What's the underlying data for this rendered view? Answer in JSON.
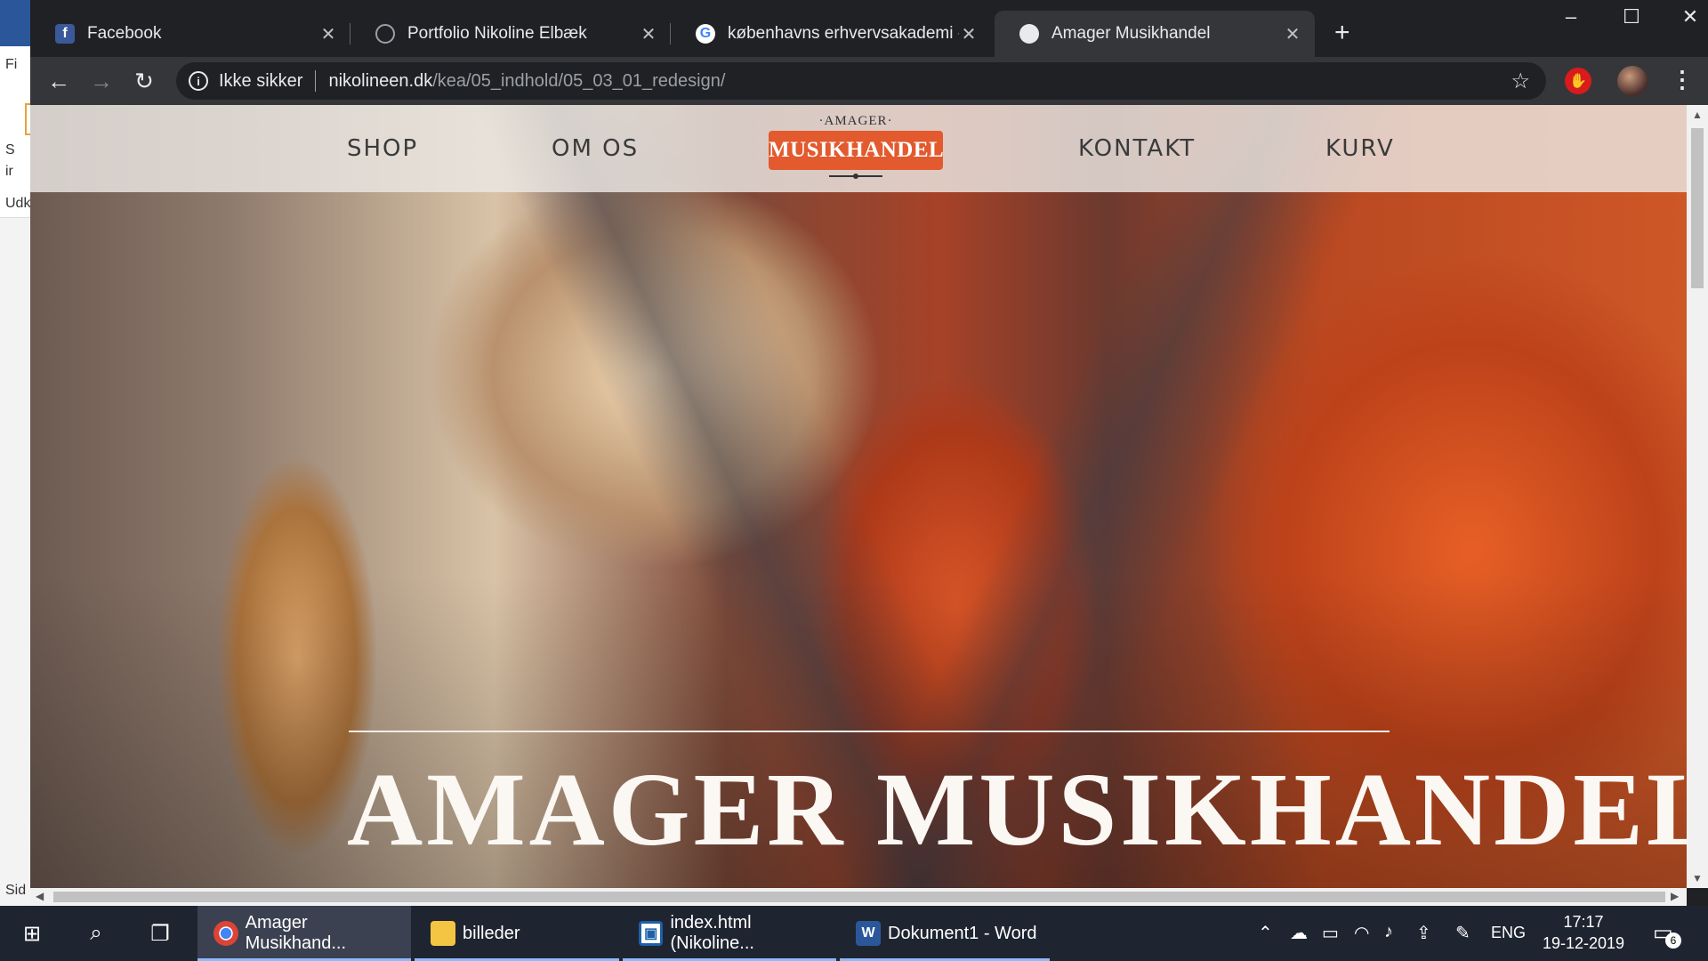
{
  "background_app": {
    "text_top": "Fi",
    "text_mid1": "S",
    "text_mid2": "ir",
    "text_udk": "Udk",
    "text_sid": "Sid"
  },
  "tabs": [
    {
      "title": "Facebook",
      "favicon": "facebook-icon"
    },
    {
      "title": "Portfolio Nikoline Elbæk",
      "favicon": "globe-icon"
    },
    {
      "title": "københavns erhvervsakademi - G",
      "favicon": "google-icon"
    },
    {
      "title": "Amager Musikhandel",
      "favicon": "globe-icon",
      "active": true
    }
  ],
  "toolbar": {
    "security_label": "Ikke sikker",
    "url_host": "nikolineen.dk",
    "url_path": "/kea/05_indhold/05_03_01_redesign/"
  },
  "site": {
    "nav": {
      "shop": "SHOP",
      "about": "OM OS",
      "contact": "KONTAKT",
      "cart": "KURV"
    },
    "logo": {
      "top": "·AMAGER·",
      "badge": "MUSIKHANDEL"
    },
    "hero_title": "AMAGER MUSIKHANDEL",
    "colors": {
      "logo_orange": "#e25a2d",
      "nav_bg": "#ebe8e4",
      "hero_text": "#fbf7f2"
    }
  },
  "taskbar": {
    "apps": [
      {
        "label": "Amager Musikhand...",
        "icon": "chrome-icon",
        "active": true
      },
      {
        "label": "billeder",
        "icon": "folder-icon"
      },
      {
        "label": "index.html (Nikoline...",
        "icon": "editor-icon"
      },
      {
        "label": "Dokument1 - Word",
        "icon": "word-icon"
      }
    ],
    "language": "ENG",
    "time": "17:17",
    "date": "19-12-2019",
    "notifications": "6"
  }
}
